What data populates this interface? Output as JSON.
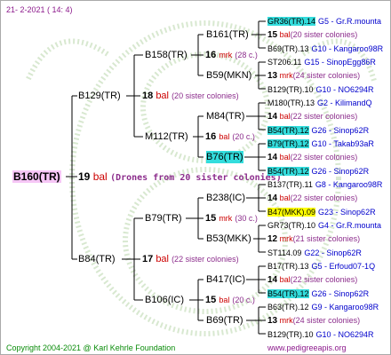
{
  "header": {
    "date": "21-  2-2021  ( 14:  4)"
  },
  "root": {
    "id": "B160(TR)"
  },
  "gen1": {
    "sire": {
      "id": "B129(TR)"
    },
    "dam": {
      "num": "19",
      "bal": "bal",
      "note": "(Drones from 20 sister colonies)"
    },
    "b": {
      "id": "B84(TR)"
    }
  },
  "g2": {
    "b158": {
      "id": "B158(TR)"
    },
    "n18": {
      "num": "18",
      "bal": "bal",
      "note": "(20 sister colonies)"
    },
    "m112": {
      "id": "M112(TR)"
    },
    "b79": {
      "id": "B79(TR)"
    },
    "n17": {
      "num": "17",
      "bal": "bal",
      "note": "(22 sister colonies)"
    },
    "b106": {
      "id": "B106(IC)"
    }
  },
  "g3": {
    "b161": {
      "id": "B161(TR)"
    },
    "n16a": {
      "num": "16",
      "bal": "mrk",
      "note": "(28 c.)"
    },
    "b59": {
      "id": "B59(MKN)"
    },
    "m84": {
      "id": "M84(TR)"
    },
    "n16b": {
      "num": "16",
      "bal": "bal",
      "note": "(20 c.)"
    },
    "b76": {
      "id": "B76(TR)"
    },
    "b238": {
      "id": "B238(IC)"
    },
    "n15a": {
      "num": "15",
      "bal": "mrk",
      "note": "(30 c.)"
    },
    "b53": {
      "id": "B53(MKK)"
    },
    "b417": {
      "id": "B417(IC)"
    },
    "n15b": {
      "num": "15",
      "bal": "bal",
      "note": "(20 c.)"
    },
    "b69": {
      "id": "B69(TR)"
    }
  },
  "g4": [
    {
      "a": "GR36(TR).14",
      "b": "G5 - Gr.R.mounta",
      "hl": "cyan"
    },
    {
      "num": "15",
      "bal": "bal",
      "note": "(20 sister colonies)"
    },
    {
      "a": "B69(TR).13",
      "b": "G10 - Kangaroo98R"
    },
    {
      "a": "ST206.11",
      "b": "G15 - SinopEgg86R"
    },
    {
      "num": "13",
      "bal": "mrk",
      "note": "(24 sister colonies)"
    },
    {
      "a": "B129(TR).10",
      "b": "G10 - NO6294R"
    },
    {
      "a": "M180(TR).13",
      "b": "G2 - KilimandQ"
    },
    {
      "num": "14",
      "bal": "bal",
      "note": "(22 sister colonies)"
    },
    {
      "a": "B54(TR).12",
      "b": "G26 - Sinop62R",
      "hl": "cyan"
    },
    {
      "a": "B79(TR).12",
      "b": "G10 - Takab93aR",
      "hl": "cyan"
    },
    {
      "num": "14",
      "bal": "bal",
      "note": "(22 sister colonies)"
    },
    {
      "a": "B54(TR).12",
      "b": "G26 - Sinop62R",
      "hl": "cyan"
    },
    {
      "a": "B137(TR).11",
      "b": "G8 - Kangaroo98R"
    },
    {
      "num": "14",
      "bal": "bal",
      "note": "(22 sister colonies)"
    },
    {
      "a": "B47(MKK).09",
      "b": "G23 - Sinop62R",
      "hl": "yel"
    },
    {
      "a": "GR73(TR).10",
      "b": "G4 - Gr.R.mounta"
    },
    {
      "num": "12",
      "bal": "mrk",
      "note": "(21 sister colonies)"
    },
    {
      "a": "ST114.09",
      "b": "G22 - Sinop62R"
    },
    {
      "a": "B17(TR).13",
      "b": "G5 - Erfoud07-1Q"
    },
    {
      "num": "14",
      "bal": "bal",
      "note": "(22 sister colonies)"
    },
    {
      "a": "B54(TR).12",
      "b": "G26 - Sinop62R",
      "hl": "cyan"
    },
    {
      "a": "B63(TR).12",
      "b": "G9 - Kangaroo98R"
    },
    {
      "num": "13",
      "bal": "mrk",
      "note": "(24 sister colonies)"
    },
    {
      "a": "B129(TR).10",
      "b": "G10 - NO6294R"
    }
  ],
  "footer": {
    "copyright": "Copyright 2004-2021 @ Karl Kehrle Foundation",
    "site": "www.pedigreeapis.org"
  }
}
